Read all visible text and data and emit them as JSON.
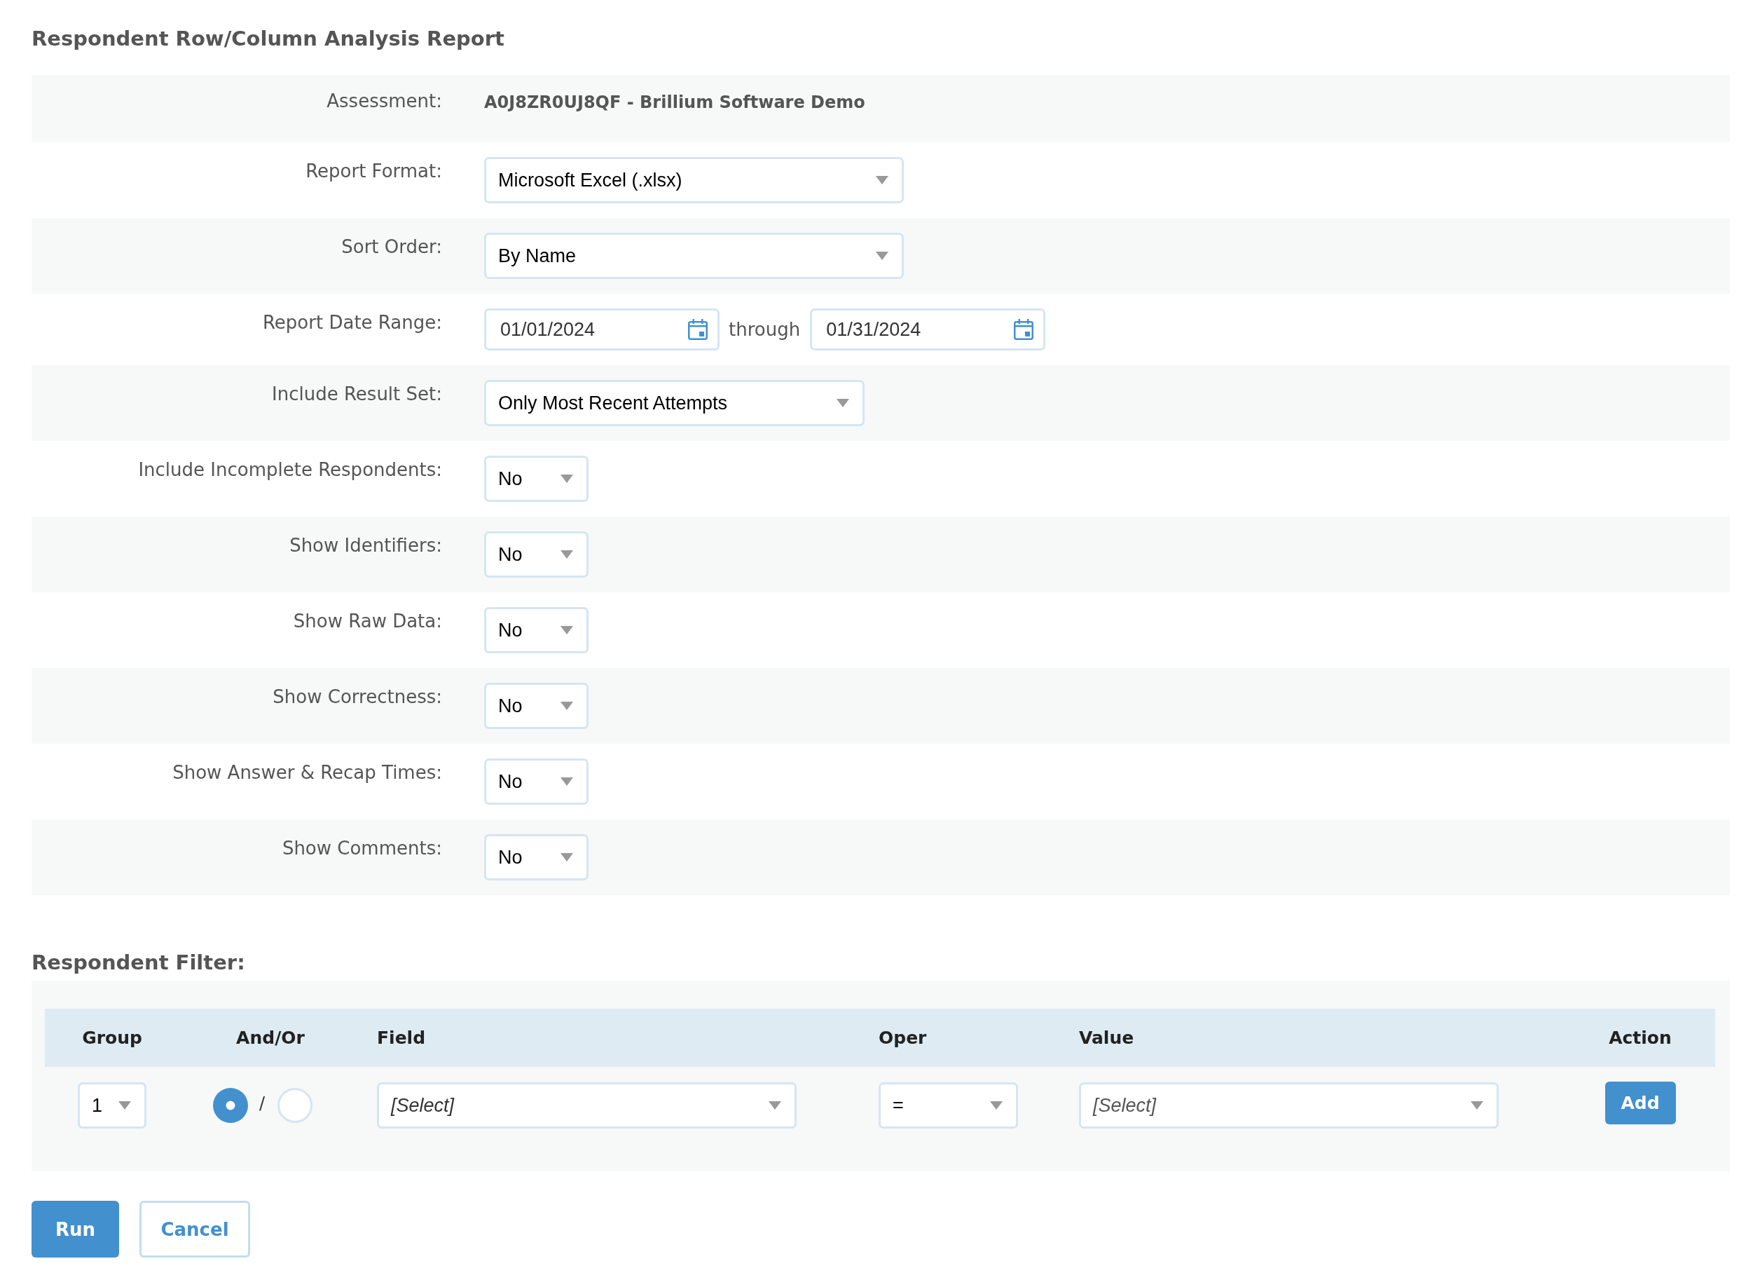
{
  "page": {
    "title": "Respondent Row/Column Analysis Report"
  },
  "form": {
    "rows": [
      {
        "kind": "text",
        "label": "Assessment:",
        "value": "A0J8ZR0UJ8QF - Brillium Software Demo"
      },
      {
        "kind": "select",
        "label": "Report Format:",
        "value": "Microsoft Excel (.xlsx)"
      },
      {
        "kind": "select",
        "label": "Sort Order:",
        "value": "By Name"
      },
      {
        "kind": "date-range",
        "label": "Report Date Range:",
        "start": "01/01/2024",
        "separator": "through",
        "end": "01/31/2024"
      },
      {
        "kind": "select",
        "label": "Include Result Set:",
        "value": "Only Most Recent Attempts"
      },
      {
        "kind": "select",
        "label": "Include Incomplete Respondents:",
        "value": "No"
      },
      {
        "kind": "select",
        "label": "Show Identifiers:",
        "value": "No"
      },
      {
        "kind": "select",
        "label": "Show Raw Data:",
        "value": "No"
      },
      {
        "kind": "select",
        "label": "Show Correctness:",
        "value": "No"
      },
      {
        "kind": "select",
        "label": "Show Answer & Recap Times:",
        "value": "No"
      },
      {
        "kind": "select",
        "label": "Show Comments:",
        "value": "No"
      }
    ]
  },
  "filter": {
    "title": "Respondent Filter:",
    "columns": [
      "Group",
      "And/Or",
      "Field",
      "Oper",
      "Value",
      "Action"
    ],
    "rows": [
      {
        "group": "1",
        "and_or": {
          "options": [
            {
              "selected": true
            },
            {
              "selected": false
            }
          ],
          "separator": "/"
        },
        "field": "[Select]",
        "oper": "=",
        "value": "[Select]",
        "action": "Add"
      }
    ]
  },
  "buttons": [
    {
      "label": "Run",
      "kind": "primary"
    },
    {
      "label": "Cancel",
      "kind": "secondary"
    }
  ]
}
